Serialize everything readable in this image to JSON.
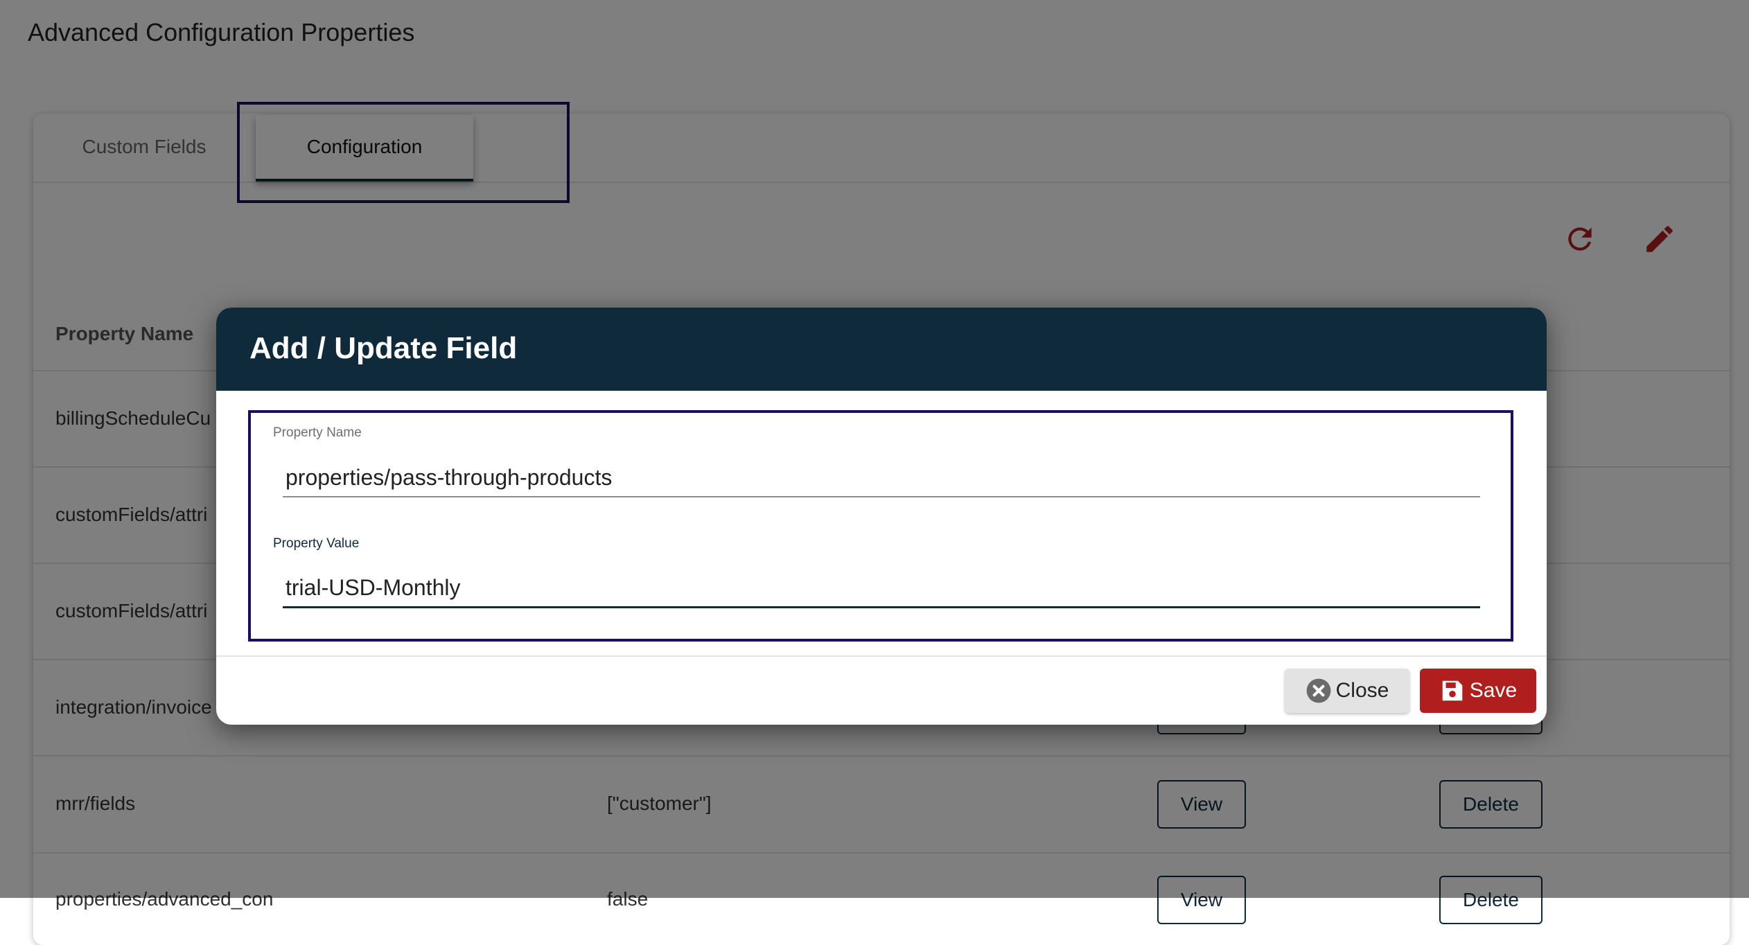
{
  "page": {
    "title": "Advanced Configuration Properties"
  },
  "tabs": [
    {
      "label": "Custom Fields"
    },
    {
      "label": "Configuration"
    }
  ],
  "toolbar": {
    "refresh_icon": "refresh-icon",
    "edit_icon": "pencil-icon"
  },
  "table": {
    "headers": {
      "property_name": "Property Name"
    },
    "rows": [
      {
        "name": "billingScheduleCu",
        "value": ""
      },
      {
        "name": "customFields/attri",
        "value": ""
      },
      {
        "name": "customFields/attri",
        "value": ""
      },
      {
        "name": "integration/invoice",
        "value": ""
      },
      {
        "name": "mrr/fields",
        "value": "[\"customer\"]",
        "view": "View",
        "delete": "Delete"
      },
      {
        "name": "properties/advanced_con",
        "value": "false",
        "view": "View",
        "delete": "Delete"
      }
    ]
  },
  "modal": {
    "title": "Add / Update Field",
    "fields": {
      "name_label": "Property Name",
      "name_value": "properties/pass-through-products",
      "value_label": "Property Value",
      "value_value": "trial-USD-Monthly"
    },
    "buttons": {
      "close": "Close",
      "save": "Save"
    }
  },
  "colors": {
    "accent": "#0f2a3b",
    "danger": "#b01e1e",
    "focus": "#1a1060"
  }
}
